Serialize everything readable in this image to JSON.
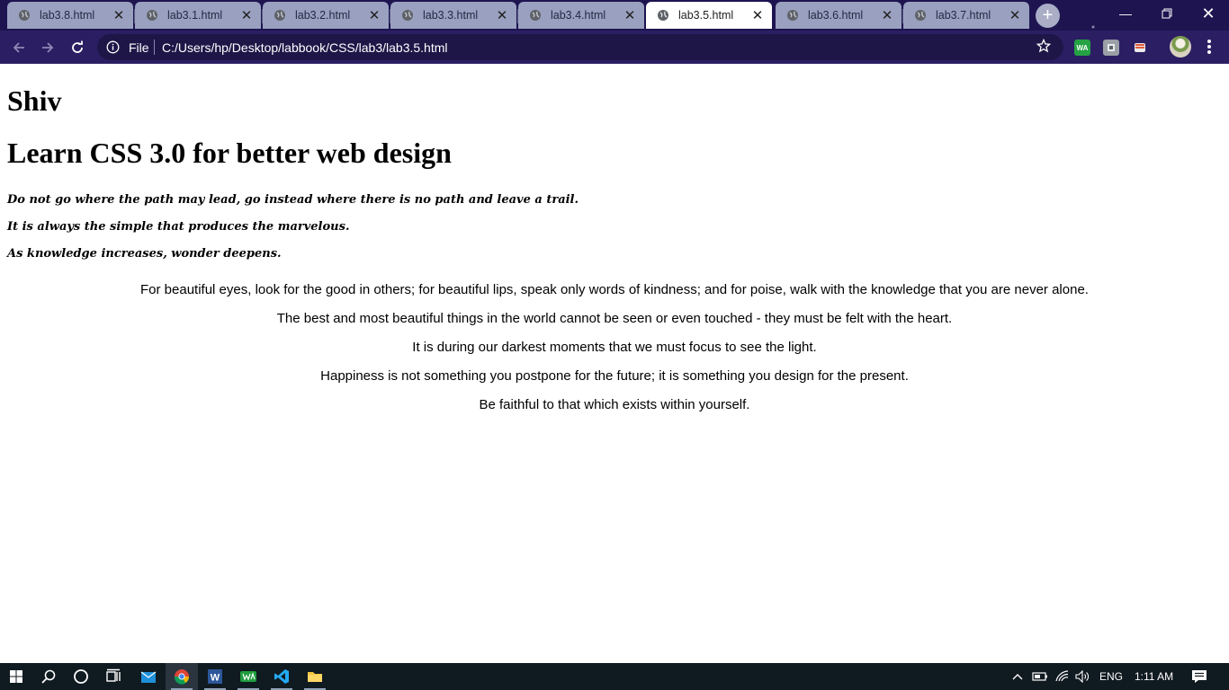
{
  "browser": {
    "tabs": [
      {
        "label": "lab3.8.html",
        "active": false
      },
      {
        "label": "lab3.1.html",
        "active": false
      },
      {
        "label": "lab3.2.html",
        "active": false
      },
      {
        "label": "lab3.3.html",
        "active": false
      },
      {
        "label": "lab3.4.html",
        "active": false
      },
      {
        "label": "lab3.5.html",
        "active": true
      },
      {
        "label": "lab3.6.html",
        "active": false
      },
      {
        "label": "lab3.7.html",
        "active": false
      }
    ],
    "omnibox": {
      "scheme_label": "File",
      "url": "C:/Users/hp/Desktop/labbook/CSS/lab3/lab3.5.html"
    },
    "extensions": [
      {
        "name": "whatsapp-extension-icon",
        "label": "WA",
        "color": "#25a244"
      },
      {
        "name": "puzzle-extension-icon",
        "label": "",
        "color": "#9aa0a6"
      },
      {
        "name": "cast-extension-icon",
        "label": "",
        "color": "#e25d3a"
      }
    ]
  },
  "page": {
    "name_heading": "Shiv",
    "title_heading": "Learn CSS 3.0 for better web design",
    "italic_quotes": [
      "Do not go where the path may lead, go instead where there is no path and leave a trail.",
      "It is always the simple that produces the marvelous.",
      "As knowledge increases, wonder deepens."
    ],
    "centered_quotes": [
      "For beautiful eyes, look for the good in others; for beautiful lips, speak only words of kindness; and for poise, walk with the knowledge that you are never alone.",
      "The best and most beautiful things in the world cannot be seen or even touched - they must be felt with the heart.",
      "It is during our darkest moments that we must focus to see the light.",
      "Happiness is not something you postpone for the future; it is something you design for the present.",
      "Be faithful to that which exists within yourself."
    ]
  },
  "taskbar": {
    "language": "ENG",
    "time": "1:11 AM"
  },
  "colors": {
    "titlebar": "#1d1450",
    "toolbar": "#2b1e63",
    "taskbar": "#101a21"
  }
}
